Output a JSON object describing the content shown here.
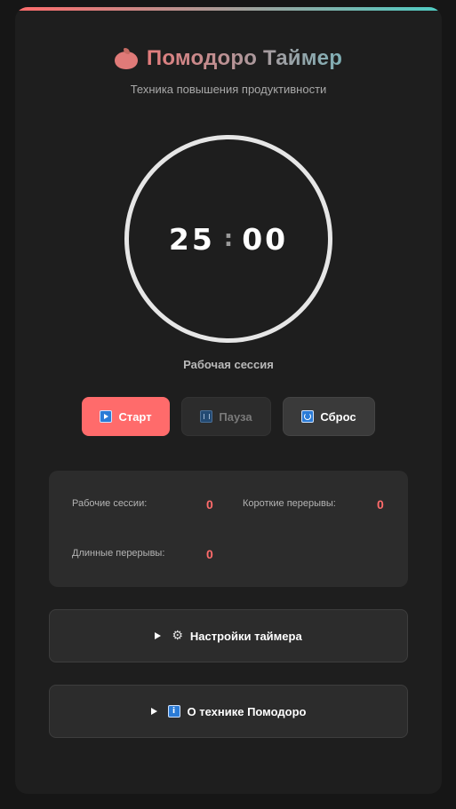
{
  "header": {
    "title": "Помодоро Таймер",
    "subtitle": "Техника повышения продуктивности",
    "icon": "tomato-icon"
  },
  "timer": {
    "minutes": "25",
    "separator": ":",
    "seconds": "00",
    "session_label": "Рабочая сессия"
  },
  "controls": {
    "start": {
      "label": "Старт",
      "icon": "play-icon"
    },
    "pause": {
      "label": "Пауза",
      "icon": "pause-icon",
      "disabled": true
    },
    "reset": {
      "label": "Сброс",
      "icon": "reset-icon"
    }
  },
  "stats": {
    "work_sessions": {
      "label": "Рабочие сессии:",
      "value": "0"
    },
    "short_breaks": {
      "label": "Короткие перерывы:",
      "value": "0"
    },
    "long_breaks": {
      "label": "Длинные перерывы:",
      "value": "0"
    }
  },
  "accordions": {
    "settings": {
      "label": "Настройки таймера",
      "icon": "gear-icon",
      "glyph": "⚙"
    },
    "about": {
      "label": "О технике Помодоро",
      "icon": "info-icon",
      "glyph": "i"
    }
  },
  "colors": {
    "accent": "#ff6b6b",
    "accent_secondary": "#4ecdc4",
    "card_background": "#1e1e1e",
    "panel_background": "#2c2c2c"
  }
}
